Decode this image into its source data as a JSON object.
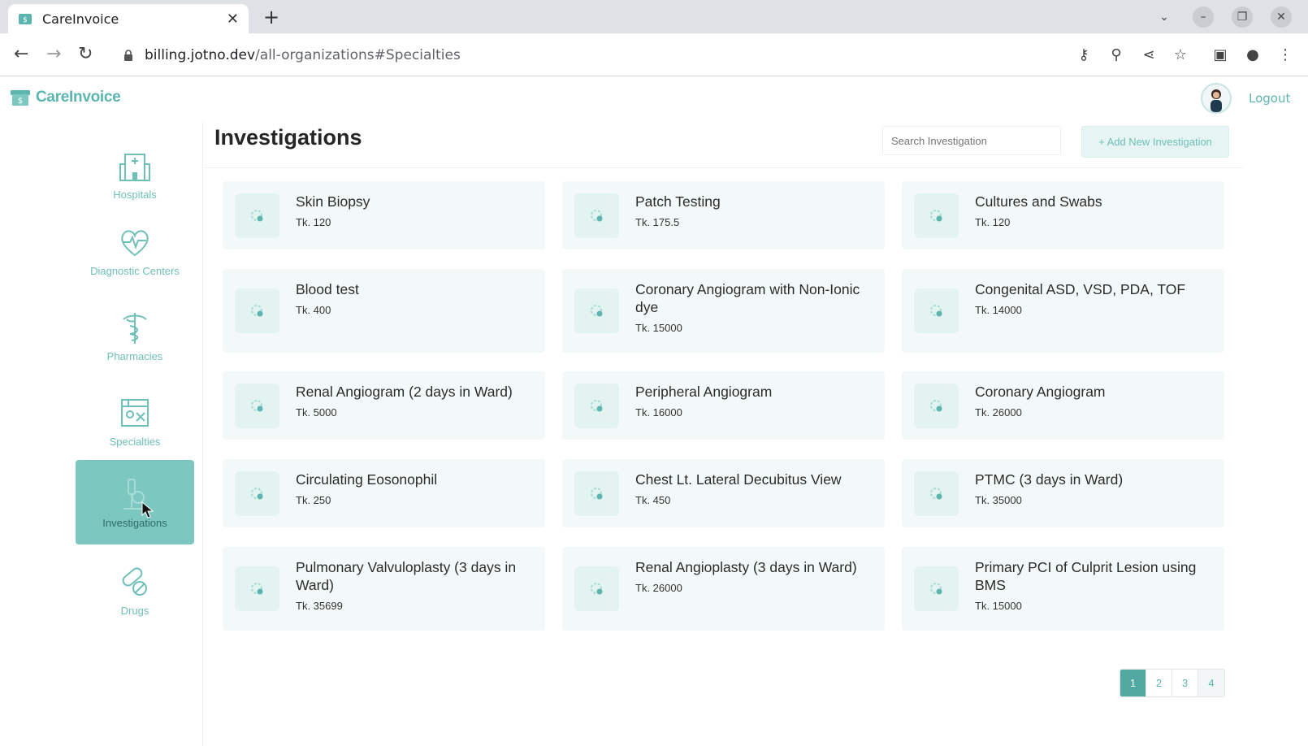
{
  "browser": {
    "tab_title": "CareInvoice",
    "url_host": "billing.jotno.dev",
    "url_path": "/all-organizations#Specialties"
  },
  "app": {
    "logo_text": "CareInvoice",
    "logout_label": "Logout",
    "accent_color": "#5cb5ae",
    "active_color": "#7cc8c0"
  },
  "sidebar": {
    "items": [
      {
        "label": "Hospitals",
        "icon": "hospital-icon"
      },
      {
        "label": "Diagnostic Centers",
        "icon": "heart-pulse-icon"
      },
      {
        "label": "Pharmacies",
        "icon": "caduceus-icon"
      },
      {
        "label": "Specialties",
        "icon": "specialties-icon"
      },
      {
        "label": "Investigations",
        "icon": "microscope-icon",
        "active": true
      },
      {
        "label": "Drugs",
        "icon": "pills-icon"
      }
    ]
  },
  "main": {
    "title": "Investigations",
    "search_placeholder": "Search Investigation",
    "add_button_label": "+ Add New Investigation",
    "cards": [
      {
        "name": "Skin Biopsy",
        "price": "Tk. 120"
      },
      {
        "name": "Patch Testing",
        "price": "Tk. 175.5"
      },
      {
        "name": "Cultures and Swabs",
        "price": "Tk. 120"
      },
      {
        "name": "Blood test",
        "price": "Tk. 400"
      },
      {
        "name": "Coronary Angiogram with Non-Ionic dye",
        "price": "Tk. 15000"
      },
      {
        "name": "Congenital ASD, VSD, PDA, TOF",
        "price": "Tk. 14000"
      },
      {
        "name": "Renal Angiogram (2 days in Ward)",
        "price": "Tk. 5000"
      },
      {
        "name": "Peripheral Angiogram",
        "price": "Tk. 16000"
      },
      {
        "name": "Coronary Angiogram",
        "price": "Tk. 26000"
      },
      {
        "name": "Circulating Eosonophil",
        "price": "Tk. 250"
      },
      {
        "name": "Chest Lt. Lateral Decubitus View",
        "price": "Tk. 450"
      },
      {
        "name": "PTMC (3 days in Ward)",
        "price": "Tk. 35000"
      },
      {
        "name": "Pulmonary Valvuloplasty (3 days in Ward)",
        "price": "Tk. 35699"
      },
      {
        "name": "Renal Angioplasty (3 days in Ward)",
        "price": "Tk. 26000"
      },
      {
        "name": "Primary PCI of Culprit Lesion using BMS",
        "price": "Tk. 15000"
      }
    ],
    "pagination": [
      "1",
      "2",
      "3",
      "4"
    ],
    "current_page": "1"
  }
}
